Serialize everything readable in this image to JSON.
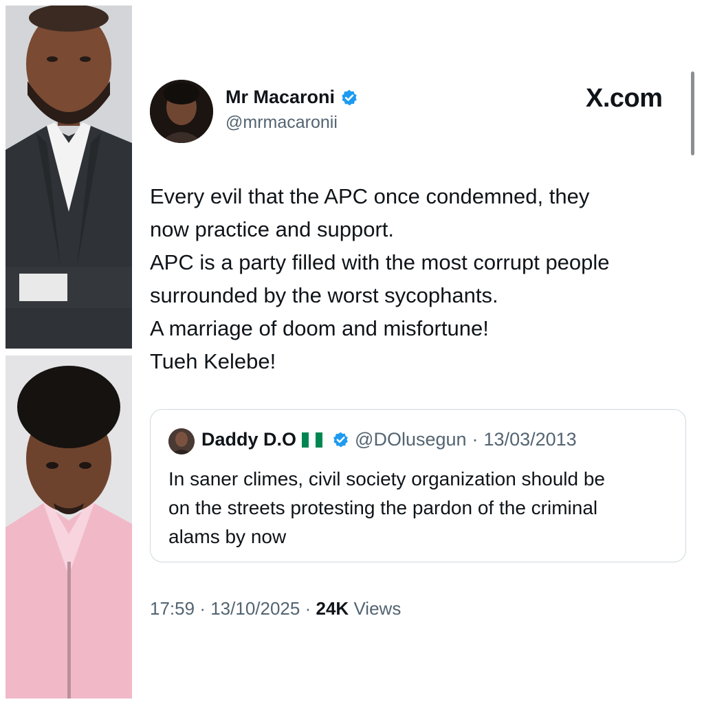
{
  "tweet": {
    "display_name": "Mr Macaroni",
    "handle": "@mrmacaronii",
    "verified_icon": "verified-badge-icon",
    "brand": "X.com",
    "body_lines": [
      "Every evil that the APC once condemned, they",
      "now practice and support.",
      "APC is a party filled with the most corrupt people",
      "surrounded by the worst sycophants.",
      "A marriage of doom and misfortune!",
      "Tueh Kelebe!"
    ],
    "time": "17:59",
    "date": "13/10/2025",
    "views_count": "24K",
    "views_label": "Views",
    "separator": "·"
  },
  "quote": {
    "display_name": "Daddy D.O",
    "flag_icon": "nigeria-flag-icon",
    "handle": "@DOlusegun",
    "separator": "·",
    "date": "13/03/2013",
    "text_lines": [
      "In saner climes, civil society organization should be",
      "on the streets protesting the pardon of the criminal",
      "alams by now"
    ]
  },
  "colors": {
    "verified_blue": "#1d9bf0",
    "text": "#0f1419",
    "secondary": "#536471",
    "border": "#cfd9de",
    "flag_green": "#008751"
  }
}
